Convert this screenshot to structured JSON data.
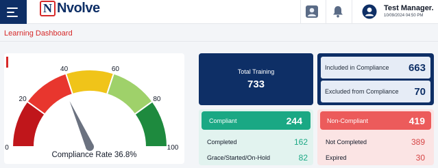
{
  "header": {
    "brand": {
      "mark": "N",
      "text": "Nvolve"
    },
    "icons": [
      "menu-icon",
      "profile-card-icon",
      "bell-icon",
      "user-avatar-icon"
    ],
    "user": {
      "name": "Test Manager.",
      "datetime": "10/09/2024 04:50 PM"
    }
  },
  "page": {
    "title": "Learning Dashboard"
  },
  "gauge": {
    "ticks": [
      "0",
      "20",
      "40",
      "60",
      "80",
      "100"
    ],
    "caption_label": "Compliance Rate",
    "caption_value": "36.8%",
    "value": 36.8,
    "min": 0,
    "max": 100,
    "band_colors": [
      "#c0161b",
      "#e8362e",
      "#f0c419",
      "#9fd16a",
      "#1e8a3e"
    ]
  },
  "summary": {
    "total_training": {
      "label": "Total Training",
      "value": "733"
    },
    "included": {
      "label": "Included in Compliance",
      "value": "663"
    },
    "excluded": {
      "label": "Excluded from Compliance",
      "value": "70"
    }
  },
  "compliant": {
    "label": "Compliant",
    "value": "244",
    "rows": [
      {
        "label": "Completed",
        "value": "162"
      },
      {
        "label": "Grace/Started/On-Hold",
        "value": "82"
      }
    ]
  },
  "non_compliant": {
    "label": "Non-Compliant",
    "value": "419",
    "rows": [
      {
        "label": "Not Completed",
        "value": "389"
      },
      {
        "label": "Expired",
        "value": "30"
      }
    ]
  },
  "colors": {
    "navy": "#0e2f66",
    "accent_red": "#d62828",
    "compliant_green": "#1aa884",
    "noncompliant_red": "#ec5b5b"
  }
}
